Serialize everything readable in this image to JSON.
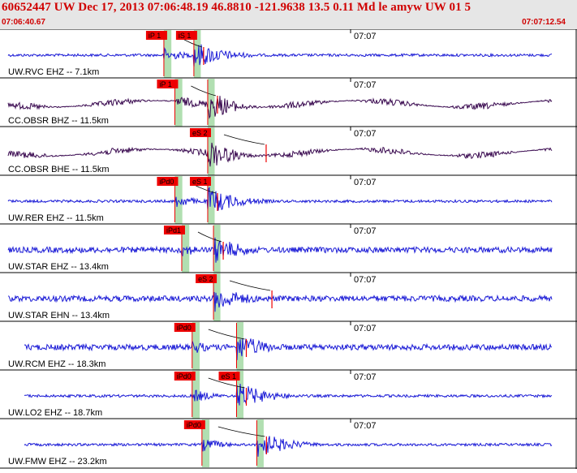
{
  "header": {
    "title": "60652447 UW Dec 17, 2013 07:06:48.19    46.8810 -121.9638 13.5 0.11 Md le amyw UW 01   5",
    "time_start": "07:06:40.67",
    "time_end": "07:07:12.54"
  },
  "colors": {
    "header_bg": "#e6e6e6",
    "header_text": "#d00000",
    "trace_vertical": "#1a1ad6",
    "trace_horizontal": "#3a0a50",
    "pick_box": "#ee0000",
    "pick_window": "#a8dca8",
    "travel_curve": "#000000",
    "panel_border": "#000000"
  },
  "minute_tick_label": "07:07",
  "traces": [
    {
      "station_label": "UW.RVC EHZ -- 7.1km",
      "kind": "vertical",
      "picks": [
        {
          "label": "iP 1",
          "t": 0.284,
          "window": [
            0.284,
            0.297
          ]
        },
        {
          "label": "iS 1",
          "t": 0.336,
          "window": [
            0.336,
            0.348
          ]
        }
      ]
    },
    {
      "station_label": "CC.OBSR BHZ -- 11.5km",
      "kind": "horizontal",
      "picks": [
        {
          "label": "iP 1",
          "t": 0.303,
          "window": [
            0.303,
            0.316
          ]
        },
        {
          "label": "",
          "t": 0.36,
          "window": [
            0.36,
            0.372
          ]
        }
      ]
    },
    {
      "station_label": "CC.OBSR BHE -- 11.5km",
      "kind": "horizontal",
      "picks": [
        {
          "label": "eS 2",
          "t": 0.36,
          "window": [
            0.36,
            0.372
          ]
        }
      ]
    },
    {
      "station_label": "UW.RER EHZ -- 11.5km",
      "kind": "vertical",
      "picks": [
        {
          "label": "iPd0",
          "t": 0.303,
          "window": [
            0.303,
            0.316
          ]
        },
        {
          "label": "eS 1",
          "t": 0.36,
          "window": [
            0.36,
            0.372
          ]
        }
      ]
    },
    {
      "station_label": "UW.STAR EHZ -- 13.4km",
      "kind": "vertical",
      "picks": [
        {
          "label": "iPd1",
          "t": 0.315,
          "window": [
            0.315,
            0.328
          ]
        },
        {
          "label": "",
          "t": 0.37,
          "window": [
            0.37,
            0.382
          ]
        }
      ]
    },
    {
      "station_label": "UW.STAR EHN -- 13.4km",
      "kind": "vertical",
      "picks": [
        {
          "label": "eS 2",
          "t": 0.37,
          "window": [
            0.37,
            0.382
          ]
        }
      ]
    },
    {
      "station_label": "UW.RCM EHZ -- 18.3km",
      "kind": "vertical",
      "picks": [
        {
          "label": "iPd0",
          "t": 0.333,
          "window": [
            0.333,
            0.346
          ]
        },
        {
          "label": "",
          "t": 0.41,
          "window": [
            0.41,
            0.422
          ]
        }
      ]
    },
    {
      "station_label": "UW.LO2 EHZ -- 18.7km",
      "kind": "vertical",
      "picks": [
        {
          "label": "iPd0",
          "t": 0.333,
          "window": [
            0.333,
            0.346
          ]
        },
        {
          "label": "eS 1",
          "t": 0.41,
          "window": [
            0.41,
            0.422
          ]
        }
      ]
    },
    {
      "station_label": "UW.FMW EHZ -- 23.2km",
      "kind": "vertical",
      "picks": [
        {
          "label": "iPd0",
          "t": 0.35,
          "window": [
            0.35,
            0.363
          ]
        },
        {
          "label": "",
          "t": 0.445,
          "window": [
            0.445,
            0.457
          ]
        }
      ]
    }
  ]
}
